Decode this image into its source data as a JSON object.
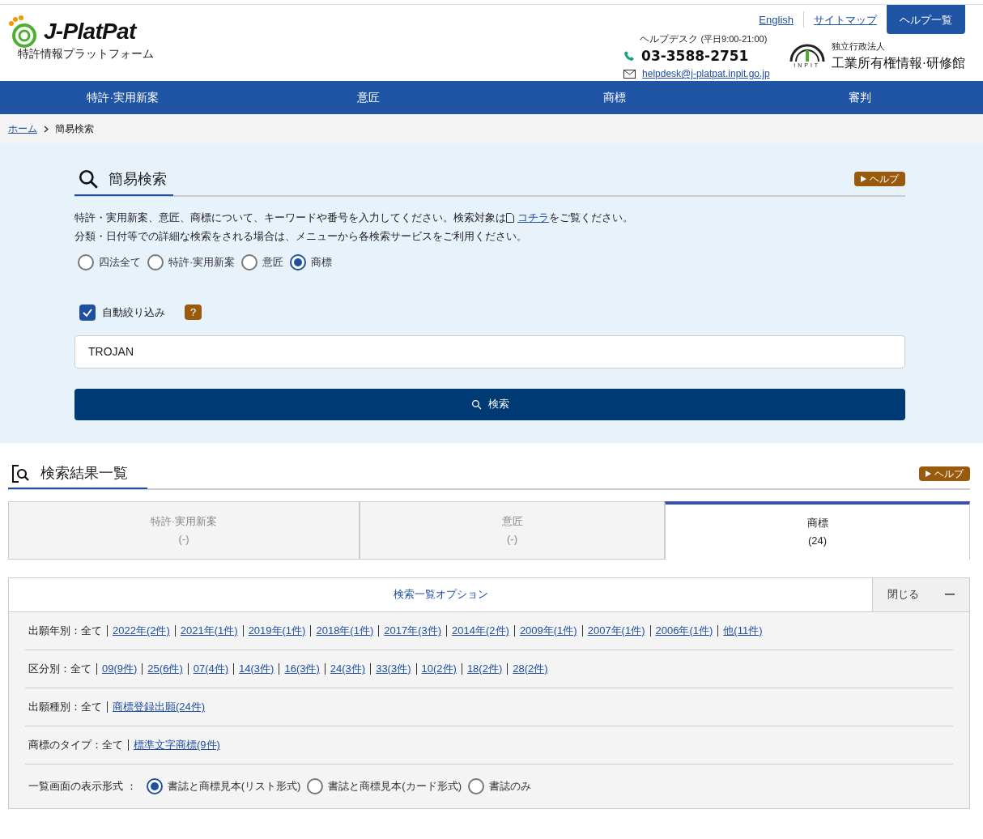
{
  "header": {
    "logo_text": "J-PlatPat",
    "subtitle": "特許情報プラットフォーム",
    "links": [
      "English",
      "サイトマップ"
    ],
    "help_button": "ヘルプ一覧",
    "helpdesk_label": "ヘルプデスク",
    "helpdesk_hours": "(平日9:00-21:00)",
    "phone": "03-3588-2751",
    "email": "helpdesk@j-platpat.inpit.go.jp",
    "org_mark": "INPIT",
    "org_type": "独立行政法人",
    "org_name": "工業所有権情報·研修館"
  },
  "nav": [
    "特許·実用新案",
    "意匠",
    "商標",
    "審判"
  ],
  "breadcrumb": [
    "ホーム",
    "簡易検索"
  ],
  "search": {
    "title": "簡易検索",
    "help": "ヘルプ",
    "description_1": {
      "before": "特許・実用新案、意匠、商標について、キーワードや番号を入力してください。検索対象は",
      "link": "コチラ",
      "after": "をご覧ください。"
    },
    "description_2": "分類・日付等での詳細な検索をされる場合は、メニューから各検索サービスをご利用ください。",
    "scopes": [
      {
        "label": "四法全て",
        "selected": false
      },
      {
        "label": "特許·実用新案",
        "selected": false
      },
      {
        "label": "意匠",
        "selected": false
      },
      {
        "label": "商標",
        "selected": true
      }
    ],
    "auto_filter": {
      "label": "自動絞り込み",
      "checked": true,
      "help_mark": "?"
    },
    "query": "TROJAN",
    "button": "検索"
  },
  "results": {
    "title": "検索結果一覧",
    "help": "ヘルプ",
    "tabs": [
      {
        "label": "特許·実用新案",
        "count": "(-)",
        "selected": false
      },
      {
        "label": "意匠",
        "count": "(-)",
        "selected": false
      },
      {
        "label": "商標",
        "count": "(24)",
        "selected": true
      }
    ],
    "options": {
      "title": "検索一覧オプション",
      "close": "閉じる",
      "filters": [
        {
          "label": "出願年別：全て",
          "links": [
            "2022年(2件)",
            "2021年(1件)",
            "2019年(1件)",
            "2018年(1件)",
            "2017年(3件)",
            "2014年(2件)",
            "2009年(1件)",
            "2007年(1件)",
            "2006年(1件)",
            "他(11件)"
          ]
        },
        {
          "label": "区分別：全て",
          "links": [
            "09(9件)",
            "25(6件)",
            "07(4件)",
            "14(3件)",
            "16(3件)",
            "24(3件)",
            "33(3件)",
            "10(2件)",
            "18(2件)",
            "28(2件)"
          ]
        },
        {
          "label": "出願種別：全て",
          "links": [
            "商標登録出願(24件)"
          ]
        },
        {
          "label": "商標のタイプ：全て",
          "links": [
            "標準文字商標(9件)"
          ]
        }
      ],
      "display_label": "一覧画面の表示形式 ：",
      "display_formats": [
        {
          "label": "書誌と商標見本(リスト形式)",
          "selected": true
        },
        {
          "label": "書誌と商標見本(カード形式)",
          "selected": false
        },
        {
          "label": "書誌のみ",
          "selected": false
        }
      ]
    }
  }
}
